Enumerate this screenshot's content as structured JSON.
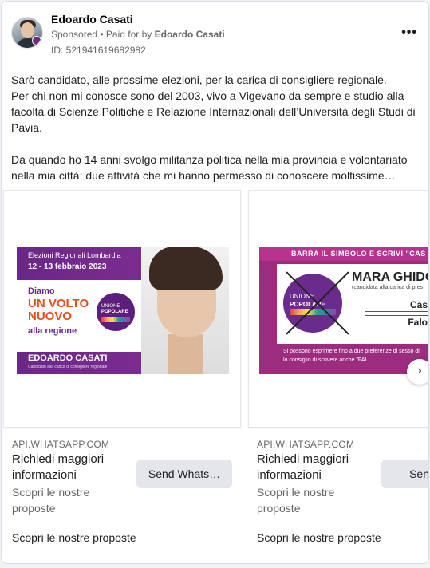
{
  "header": {
    "name": "Edoardo Casati",
    "sponsored": "Sponsored",
    "paid_for_prefix": "• Paid for by",
    "paid_for_name": "Edoardo Casati",
    "ad_id": "ID: 521941619682982",
    "more_label": "•••"
  },
  "post": {
    "paragraph1": "Sarò candidato, alle prossime elezioni, per la carica di consigliere regionale.",
    "paragraph2": "Per chi non mi conosce sono del 2003, vivo a Vigevano da sempre e studio alla facoltà di Scienze Politiche e Relazione Internazionali dell’Università degli Studi di Pavia.",
    "paragraph3": "Da quando ho 14 anni svolgo militanza politica nella mia provincia e volontariato nella mia città: due attività che mi hanno permesso di conoscere moltissime…"
  },
  "carousel": {
    "next_label": "›",
    "slides": [
      {
        "banner": {
          "top": "Elezioni Regionali Lombardia",
          "date": "12 - 13 febbraio 2023",
          "line1": "Diamo",
          "line2": "UN VOLTO",
          "line3": "NUOVO",
          "line4": "alla regione",
          "logo_top": "UNIONE",
          "logo_bottom": "POPOLARE",
          "name": "EDOARDO CASATI",
          "subtitle": "Candidato alla carica di consigliere regionale"
        },
        "domain": "API.WHATSAPP.COM",
        "title": "Richiedi maggiori informazioni",
        "description": "Scopri le nostre proposte",
        "button": "Send Whats…",
        "footer": "Scopri le nostre proposte"
      },
      {
        "banner": {
          "top": "BARRA IL SIMBOLO E SCRIVI \"CAS",
          "candidate": "MARA GHIDO",
          "candidate_sub": "(candidata alla carica di pres",
          "logo_top": "UNIONE",
          "logo_bottom": "POPOLARE",
          "box1": "Casati",
          "box2": "Falossi",
          "foot1": "Si possono esprimere fino a due preferenze di sesso di",
          "foot2": "lo consiglio di scrivere anche \"FAL"
        },
        "domain": "API.WHATSAPP.COM",
        "title": "Richiedi maggiori informazioni",
        "description": "Scopri le nostre proposte",
        "button": "Send W",
        "footer": "Scopri le nostre proposte"
      }
    ]
  },
  "colors": {
    "brand_purple": "#6a2787",
    "accent_orange": "#e74d1d",
    "button_bg": "#e4e6eb",
    "secondary_text": "#65676b"
  }
}
